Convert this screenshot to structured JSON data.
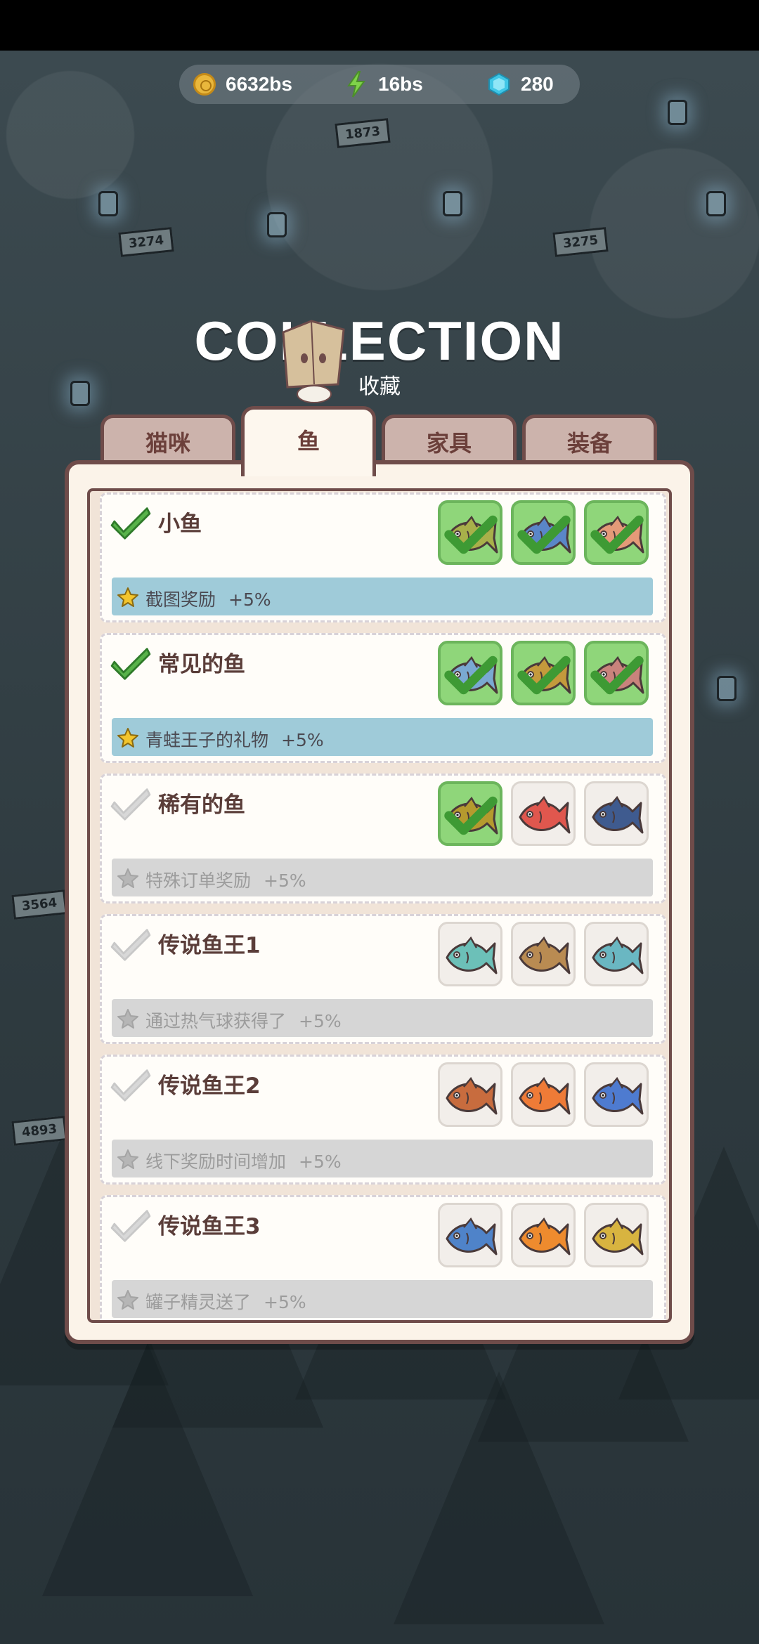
{
  "resources": {
    "coins": "6632bs",
    "energy": "16bs",
    "gems": "280"
  },
  "header": {
    "title": "COLLECTION",
    "subtitle": "收藏"
  },
  "tabs": [
    {
      "label": "猫咪",
      "active": false
    },
    {
      "label": "鱼",
      "active": true
    },
    {
      "label": "家具",
      "active": false
    },
    {
      "label": "装备",
      "active": false
    }
  ],
  "sets": [
    {
      "name": "小鱼",
      "completed": true,
      "reward": "截图奖励",
      "bonus": "+5%",
      "fish": [
        {
          "icon": "pike-fish-icon",
          "collected": true,
          "color": "#a8b04a"
        },
        {
          "icon": "tuna-fish-icon",
          "collected": true,
          "color": "#5a86c8"
        },
        {
          "icon": "salmon-fish-icon",
          "collected": true,
          "color": "#e49a78"
        }
      ]
    },
    {
      "name": "常见的鱼",
      "completed": true,
      "reward": "青蛙王子的礼物",
      "bonus": "+5%",
      "fish": [
        {
          "icon": "piranha-fish-icon",
          "collected": true,
          "color": "#7aa9d2"
        },
        {
          "icon": "carp-fish-icon",
          "collected": true,
          "color": "#c49a3c"
        },
        {
          "icon": "mackerel-fish-icon",
          "collected": true,
          "color": "#c9837c"
        }
      ]
    },
    {
      "name": "稀有的鱼",
      "completed": false,
      "reward": "特殊订单奖励",
      "bonus": "+5%",
      "fish": [
        {
          "icon": "flounder-fish-icon",
          "collected": true,
          "color": "#b59a2e"
        },
        {
          "icon": "red-snapper-fish-icon",
          "collected": false,
          "color": "#e0574e"
        },
        {
          "icon": "grouper-fish-icon",
          "collected": false,
          "color": "#3f5b8f"
        }
      ]
    },
    {
      "name": "传说鱼王1",
      "completed": false,
      "reward": "通过热气球获得了",
      "bonus": "+5%",
      "fish": [
        {
          "icon": "trout-fish-icon",
          "collected": false,
          "color": "#6cc0b8"
        },
        {
          "icon": "sole-fish-icon",
          "collected": false,
          "color": "#b98b52"
        },
        {
          "icon": "parrot-fish-icon",
          "collected": false,
          "color": "#6ab7c2"
        }
      ]
    },
    {
      "name": "传说鱼王2",
      "completed": false,
      "reward": "线下奖励时间增加",
      "bonus": "+5%",
      "fish": [
        {
          "icon": "spotted-grouper-fish-icon",
          "collected": false,
          "color": "#c86c3e"
        },
        {
          "icon": "clown-fish-icon",
          "collected": false,
          "color": "#ef7b37"
        },
        {
          "icon": "blue-tang-fish-icon",
          "collected": false,
          "color": "#4e7bd0"
        }
      ]
    },
    {
      "name": "传说鱼王3",
      "completed": false,
      "reward": "罐子精灵送了",
      "bonus": "+5%",
      "fish": [
        {
          "icon": "bluefin-tuna-fish-icon",
          "collected": false,
          "color": "#4f83c9"
        },
        {
          "icon": "golden-perch-fish-icon",
          "collected": false,
          "color": "#ee8b2e"
        },
        {
          "icon": "yellow-sturgeon-fish-icon",
          "collected": false,
          "color": "#d8b440"
        }
      ]
    }
  ]
}
